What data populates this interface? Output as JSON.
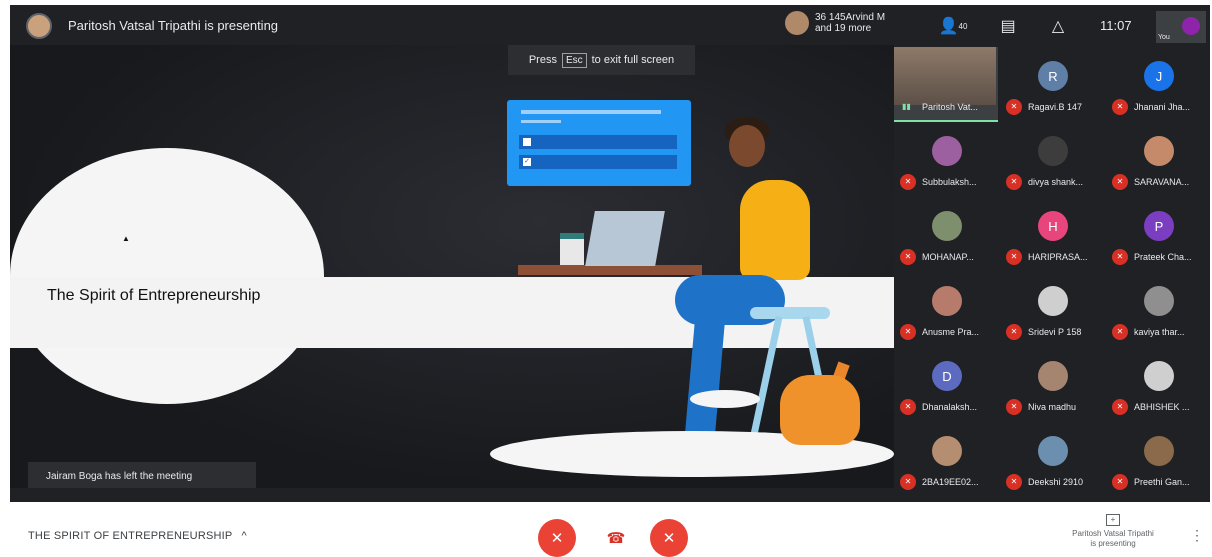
{
  "topbar": {
    "presenting_title": "Paritosh Vatsal Tripathi is presenting",
    "participants_preview_line1": "36 145Arvind M",
    "participants_preview_line2": "and 19 more",
    "people_count": "40",
    "time": "11:07",
    "self_label": "You",
    "icons": [
      "people-icon",
      "chat-icon",
      "activities-icon"
    ]
  },
  "stage": {
    "esc_hint_before": "Press",
    "esc_key": "Esc",
    "esc_hint_after": "to exit full screen",
    "slide_title": "The Spirit of Entrepreneurship",
    "toast": "Jairam Boga has left the meeting",
    "card_check": "✓"
  },
  "participants": [
    {
      "name": "Paritosh Vat...",
      "initial": "",
      "color": "#6b5c51",
      "muted": false,
      "photo": true
    },
    {
      "name": "Ragavi.B 147",
      "initial": "R",
      "color": "#5f7fa7",
      "muted": true
    },
    {
      "name": "Jhanani Jha...",
      "initial": "J",
      "color": "#1a73e8",
      "muted": true
    },
    {
      "name": "Subbulaksh...",
      "initial": "",
      "color": "#9c5f9f",
      "muted": true
    },
    {
      "name": "divya shank...",
      "initial": "",
      "color": "#3d3d3d",
      "muted": true
    },
    {
      "name": "SARAVANA...",
      "initial": "",
      "color": "#c58a6a",
      "muted": true
    },
    {
      "name": "MOHANAP...",
      "initial": "",
      "color": "#7e8f6e",
      "muted": true
    },
    {
      "name": "HARIPRASA...",
      "initial": "H",
      "color": "#e8457c",
      "muted": true
    },
    {
      "name": "Prateek Cha...",
      "initial": "P",
      "color": "#7b3ec1",
      "muted": true
    },
    {
      "name": "Anusme Pra...",
      "initial": "",
      "color": "#b77b6b",
      "muted": true
    },
    {
      "name": "Sridevi P 158",
      "initial": "",
      "color": "#cfcfcf",
      "muted": true
    },
    {
      "name": "kaviya thar...",
      "initial": "",
      "color": "#8f8f8f",
      "muted": true
    },
    {
      "name": "Dhanalaksh...",
      "initial": "D",
      "color": "#5c6bc0",
      "muted": true
    },
    {
      "name": "Niva madhu",
      "initial": "",
      "color": "#a58470",
      "muted": true
    },
    {
      "name": "ABHISHEK ...",
      "initial": "",
      "color": "#cfcfcf",
      "muted": true
    },
    {
      "name": "2BA19EE02...",
      "initial": "",
      "color": "#b58d70",
      "muted": true
    },
    {
      "name": "Deekshi 2910",
      "initial": "",
      "color": "#6c8fb0",
      "muted": true
    },
    {
      "name": "Preethi Gan...",
      "initial": "",
      "color": "#8a6a4a",
      "muted": true
    }
  ],
  "bottombar": {
    "meeting_title": "THE SPIRIT OF ENTREPRENEURSHIP",
    "chevron": "^",
    "present_line1": "Paritosh Vatsal Tripathi",
    "present_line2": "is presenting",
    "more": "⋮",
    "controls": {
      "mic_icon": "✕",
      "hangup_icon": "☎",
      "camera_icon": "✕",
      "control_color": "#ea4335"
    }
  }
}
